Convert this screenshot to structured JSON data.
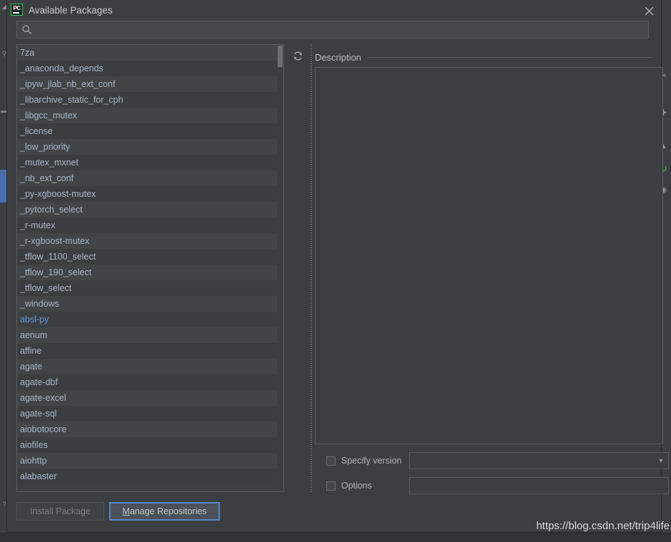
{
  "window": {
    "title": "Available Packages",
    "app_icon": "pycharm-logo-icon",
    "app_icon_text": "PC",
    "close_icon": "close-icon"
  },
  "search": {
    "value": "",
    "placeholder": "",
    "icon": "search-icon"
  },
  "package_list": {
    "refresh_icon": "refresh-icon",
    "highlighted_package": "absl-py",
    "items": [
      "7za",
      "_anaconda_depends",
      "_ipyw_jlab_nb_ext_conf",
      "_libarchive_static_for_cph",
      "_libgcc_mutex",
      "_license",
      "_low_priority",
      "_mutex_mxnet",
      "_nb_ext_conf",
      "_py-xgboost-mutex",
      "_pytorch_select",
      "_r-mutex",
      "_r-xgboost-mutex",
      "_tflow_1100_select",
      "_tflow_190_select",
      "_tflow_select",
      "_windows",
      "absl-py",
      "aenum",
      "affine",
      "agate",
      "agate-dbf",
      "agate-excel",
      "agate-sql",
      "aiobotocore",
      "aiofiles",
      "aiohttp",
      "alabaster"
    ]
  },
  "description": {
    "label": "Description",
    "text": ""
  },
  "options": {
    "specify_version": {
      "label": "Specify version",
      "checked": false,
      "value": "",
      "arrow_icon": "chevron-down-icon"
    },
    "options_field": {
      "label": "Options",
      "checked": false,
      "value": "",
      "placeholder": ""
    }
  },
  "buttons": {
    "install_package": "Install Package",
    "manage_repositories_mnemonic": "M",
    "manage_repositories_rest": "anage Repositories"
  },
  "watermark": {
    "text": "https://blog.csdn.net/trip4life"
  },
  "colors": {
    "dialog_background": "#3c3f41",
    "list_row_odd": "#414547",
    "list_row_even": "#3b3e40",
    "text_primary": "#a9b7c6",
    "highlight_text": "#5f9ad8",
    "focus_border": "#5788c7",
    "accent_blue": "#4a6daf",
    "accent_green": "#2fd06a"
  }
}
